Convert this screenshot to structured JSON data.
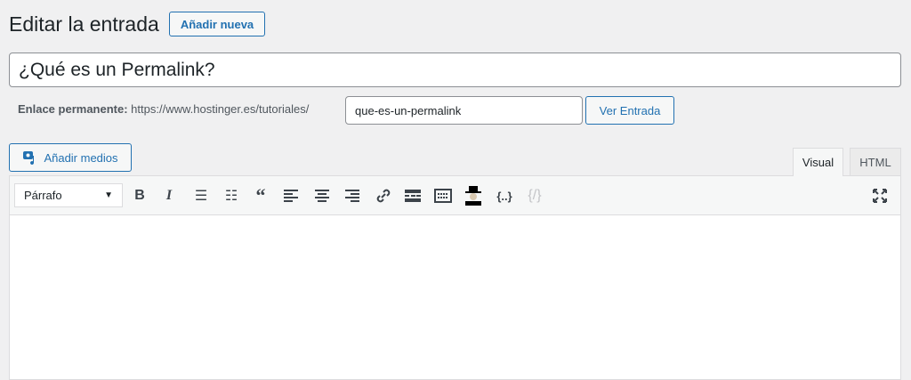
{
  "header": {
    "title": "Editar la entrada",
    "add_new": "Añadir nueva"
  },
  "post": {
    "title": "¿Qué es un Permalink?"
  },
  "permalink": {
    "label": "Enlace permanente:",
    "base": "https://www.hostinger.es/tutoriales/",
    "slug": "que-es-un-permalink",
    "view": "Ver Entrada"
  },
  "media": {
    "label": "Añadir medios"
  },
  "tabs": {
    "visual": "Visual",
    "html": "HTML"
  },
  "toolbar": {
    "format": "Párrafo",
    "braces": "{..}"
  }
}
